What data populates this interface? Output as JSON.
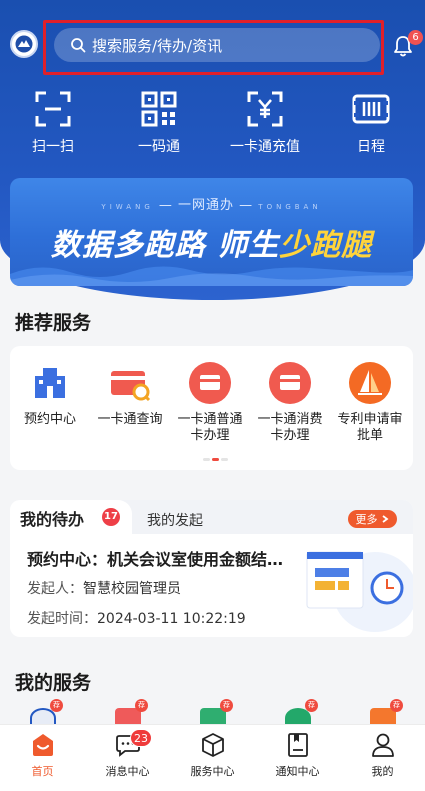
{
  "header": {
    "search_placeholder": "搜索服务/待办/资讯",
    "notification_count": "6"
  },
  "quick_actions": [
    {
      "label": "扫一扫",
      "icon": "scan-icon"
    },
    {
      "label": "一码通",
      "icon": "qrcode-icon"
    },
    {
      "label": "一卡通充值",
      "icon": "card-recharge-icon"
    },
    {
      "label": "日程",
      "icon": "schedule-icon"
    }
  ],
  "banner": {
    "subtitle": "一网通办",
    "pinyin_left": "YIWANG",
    "pinyin_right": "TONGBAN",
    "headline_part1": "数据多跑路 师生",
    "headline_highlight": "少跑腿"
  },
  "recommended": {
    "title": "推荐服务",
    "items": [
      {
        "label": "预约中心",
        "icon": "building-icon",
        "color": "#3b6fe0"
      },
      {
        "label": "一卡通查询",
        "icon": "card-search-icon",
        "color": "#f05a4f"
      },
      {
        "label": "一卡通普通卡办理",
        "icon": "card-icon",
        "color": "#f05a4f"
      },
      {
        "label": "一卡通消费卡办理",
        "icon": "card-icon",
        "color": "#f05a4f"
      },
      {
        "label": "专利申请审批单",
        "icon": "sail-icon",
        "color": "#f46a24"
      }
    ]
  },
  "todo": {
    "tab_active": "我的待办",
    "badge": "17",
    "tab_other": "我的发起",
    "more": "更多",
    "item_title": "预约中心：机关会议室使用金额结算审批",
    "initiator_label": "发起人：",
    "initiator": "智慧校园管理员",
    "time_label": "发起时间：",
    "time": "2024-03-11 10:22:19"
  },
  "my_services": {
    "title": "我的服务",
    "tag": "荐"
  },
  "tabbar": [
    {
      "label": "首页",
      "icon": "home-icon",
      "active": true
    },
    {
      "label": "消息中心",
      "icon": "message-icon",
      "badge": "23"
    },
    {
      "label": "服务中心",
      "icon": "box-icon"
    },
    {
      "label": "通知中心",
      "icon": "notice-icon"
    },
    {
      "label": "我的",
      "icon": "user-icon"
    }
  ],
  "colors": {
    "primary": "#2358c2",
    "accent": "#ef5a2d",
    "badge": "#ee3f47"
  }
}
